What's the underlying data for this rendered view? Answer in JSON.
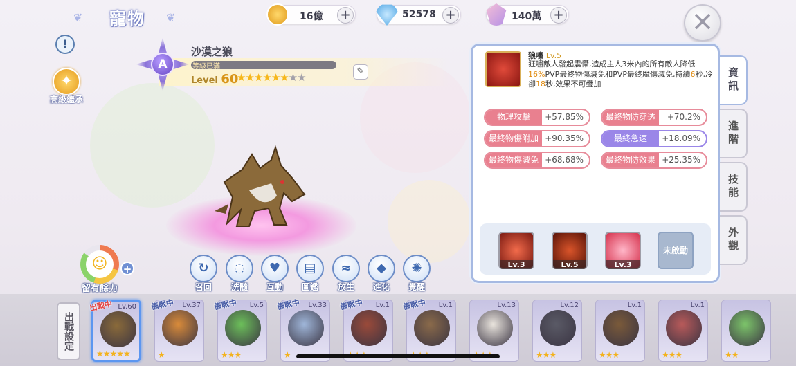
{
  "header": {
    "title": "寵物"
  },
  "currencies": [
    {
      "name": "zeny",
      "value": "16億",
      "color": "#f2b63a"
    },
    {
      "name": "diamond",
      "value": "52578",
      "color": "#6fb8ee"
    },
    {
      "name": "crystal",
      "value": "140萬",
      "color": "#f28fb4"
    }
  ],
  "left": {
    "legacy_label": "高級繼承",
    "info_icon": "!"
  },
  "pet": {
    "rank": "A",
    "name": "沙漠之狼",
    "status": "等級已滿",
    "level_label": "Level",
    "level": "60",
    "stars_filled": 6,
    "stars_total": 8
  },
  "skill": {
    "name": "狼嚎",
    "level": "Lv.5",
    "desc": [
      {
        "t": "狂嘯敵人發起震懾,造成主人3米內的所有敵人降低"
      },
      {
        "t": "16%",
        "hl": true
      },
      {
        "t": "PVP最終物傷減免和PVP最終魔傷減免,持續"
      },
      {
        "t": "6",
        "hl": true
      },
      {
        "t": "秒,冷卻"
      },
      {
        "t": "18",
        "hl": true
      },
      {
        "t": "秒,效果不可疊加"
      }
    ]
  },
  "stats": [
    {
      "name": "物理攻擊",
      "value": "+57.85%",
      "style": "red"
    },
    {
      "name": "最終物防穿透",
      "value": "+70.2%",
      "style": "red"
    },
    {
      "name": "最終物傷附加",
      "value": "+90.35%",
      "style": "red"
    },
    {
      "name": "最終急速",
      "value": "+18.09%",
      "style": "purple"
    },
    {
      "name": "最終物傷減免",
      "value": "+68.68%",
      "style": "red"
    },
    {
      "name": "最終物防效果",
      "value": "+25.35%",
      "style": "red"
    }
  ],
  "skills": [
    {
      "level": "Lv.3",
      "icon": "claw-slash-icon"
    },
    {
      "level": "Lv.5",
      "icon": "meteor-icon"
    },
    {
      "level": "Lv.3",
      "icon": "fire-orb-icon"
    },
    {
      "level": "",
      "locked_label": "未啟動"
    }
  ],
  "tabs": [
    "資訊",
    "進階",
    "技能",
    "外觀"
  ],
  "actions": [
    "召回",
    "洗髓",
    "互動",
    "圖鑑",
    "放生",
    "進化",
    "覺醒"
  ],
  "stamina": {
    "label": "留有餘力"
  },
  "bottom": {
    "deploy_label": "出戰設定"
  },
  "roster": [
    {
      "level": "Lv.60",
      "tag": "出戰中",
      "tag_red": true,
      "stars": "★★★★★",
      "color": "#8a6a3a",
      "selected": true
    },
    {
      "level": "Lv.37",
      "tag": "備戰中",
      "stars": "★",
      "color": "#d98b3a"
    },
    {
      "level": "Lv.5",
      "tag": "備戰中",
      "stars": "★★★",
      "color": "#6cbf5a"
    },
    {
      "level": "Lv.33",
      "tag": "備戰中",
      "stars": "★",
      "color": "#9fb6d9"
    },
    {
      "level": "Lv.1",
      "tag": "備戰中",
      "stars": "★★★",
      "color": "#9a4a3a"
    },
    {
      "level": "Lv.1",
      "tag": "備戰中",
      "stars": "★★★",
      "color": "#8a6a4a"
    },
    {
      "level": "Lv.13",
      "tag": "",
      "stars": "★★★",
      "color": "#e9e4dd"
    },
    {
      "level": "Lv.12",
      "tag": "",
      "stars": "★★★",
      "color": "#5a5a66"
    },
    {
      "level": "Lv.1",
      "tag": "",
      "stars": "★★★",
      "color": "#7a5a3a"
    },
    {
      "level": "Lv.1",
      "tag": "",
      "stars": "★★★",
      "color": "#b85a5a"
    },
    {
      "level": "",
      "tag": "",
      "stars": "★★",
      "color": "#7cc46a"
    }
  ]
}
